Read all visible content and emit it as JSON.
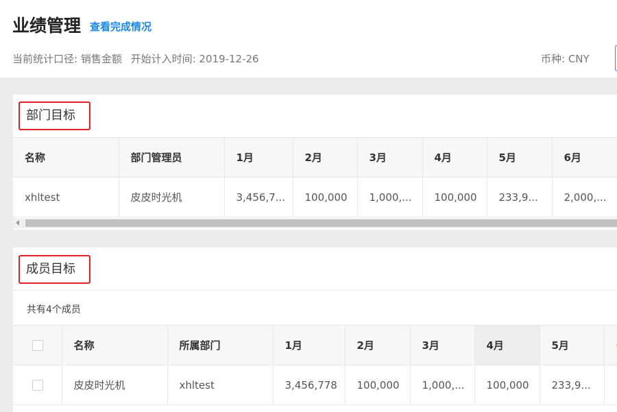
{
  "header": {
    "title": "业绩管理",
    "view_link": "查看完成情况",
    "meta_scope": "当前统计口径: 销售金额",
    "meta_start": "开始计入时间: 2019-12-26",
    "currency": "币种: CNY"
  },
  "dept_section": {
    "title": "部门目标",
    "columns": [
      "名称",
      "部门管理员",
      "1月",
      "2月",
      "3月",
      "4月",
      "5月",
      "6月"
    ],
    "rows": [
      [
        "xhltest",
        "皮皮时光机",
        "3,456,7...",
        "100,000",
        "1,000,...",
        "100,000",
        "233,9...",
        "2,000,..."
      ]
    ]
  },
  "member_section": {
    "title": "成员目标",
    "count_text": "共有4个成员",
    "columns": [
      "名称",
      "所属部门",
      "1月",
      "2月",
      "3月",
      "4月",
      "5月"
    ],
    "rows": [
      [
        "皮皮时光机",
        "xhltest",
        "3,456,778",
        "100,000",
        "1,000,...",
        "100,000",
        "233,9..."
      ]
    ]
  },
  "colors": {
    "accent": "#1e88e5",
    "highlight_border": "#e02020"
  }
}
